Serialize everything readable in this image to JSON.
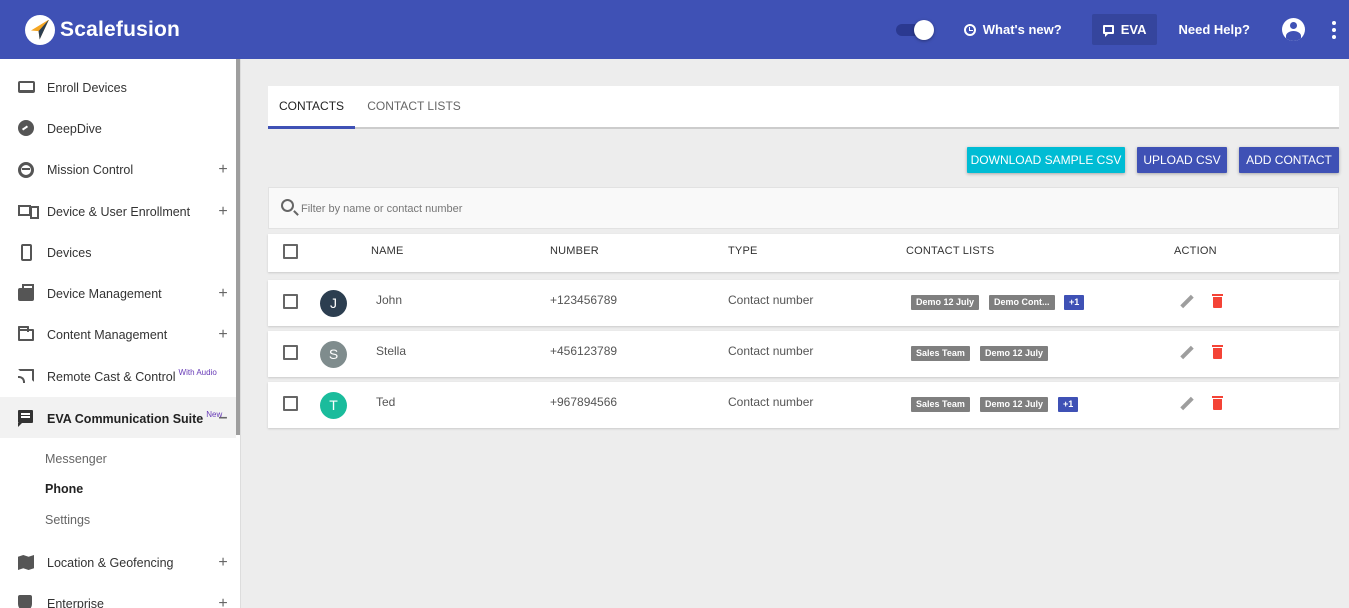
{
  "app": {
    "name": "Scalefusion"
  },
  "topbar": {
    "whats_new": "What's new?",
    "eva": "EVA",
    "help": "Need Help?"
  },
  "sidebar": {
    "items": [
      {
        "label": "Enroll Devices",
        "icon": "enroll-icon"
      },
      {
        "label": "DeepDive",
        "icon": "dashboard-icon"
      },
      {
        "label": "Mission Control",
        "icon": "mission-control-icon",
        "plus": "+"
      },
      {
        "label": "Device & User Enrollment",
        "icon": "devices-icon",
        "plus": "+"
      },
      {
        "label": "Devices",
        "icon": "phone-icon"
      },
      {
        "label": "Device Management",
        "icon": "briefcase-icon",
        "plus": "+"
      },
      {
        "label": "Content Management",
        "icon": "folder-icon",
        "plus": "+"
      },
      {
        "label": "Remote Cast & Control",
        "sup": "With Audio",
        "icon": "cast-icon"
      },
      {
        "label": "EVA Communication Suite",
        "sup": "New",
        "icon": "chat-icon",
        "plus": "–"
      },
      {
        "label": "Location & Geofencing",
        "icon": "map-icon",
        "plus": "+"
      },
      {
        "label": "Enterprise",
        "icon": "shield-icon",
        "plus": "+"
      }
    ],
    "subitems": [
      "Messenger",
      "Phone",
      "Settings"
    ]
  },
  "tabs": [
    {
      "label": "CONTACTS",
      "active": true
    },
    {
      "label": "CONTACT LISTS",
      "active": false
    }
  ],
  "actions": {
    "download": "DOWNLOAD SAMPLE CSV",
    "upload": "UPLOAD CSV",
    "add": "ADD CONTACT"
  },
  "search": {
    "placeholder": "Filter by name or contact number",
    "value": ""
  },
  "table": {
    "headers": {
      "name": "NAME",
      "number": "NUMBER",
      "type": "TYPE",
      "lists": "CONTACT LISTS",
      "action": "ACTION"
    },
    "rows": [
      {
        "initial": "J",
        "avatar_color": "#2c3e50",
        "name": "John",
        "number": "+123456789",
        "type": "Contact number",
        "chips": [
          "Demo 12 July",
          "Demo Cont..."
        ],
        "more": "+1"
      },
      {
        "initial": "S",
        "avatar_color": "#7f8c8d",
        "name": "Stella",
        "number": "+456123789",
        "type": "Contact number",
        "chips": [
          "Sales Team",
          "Demo 12 July"
        ],
        "more": ""
      },
      {
        "initial": "T",
        "avatar_color": "#1abc9c",
        "name": "Ted",
        "number": "+967894566",
        "type": "Contact number",
        "chips": [
          "Sales Team",
          "Demo 12 July"
        ],
        "more": "+1"
      }
    ]
  },
  "colors": {
    "primary": "#3f51b5",
    "accent": "#00bcd4",
    "danger": "#f44336"
  }
}
